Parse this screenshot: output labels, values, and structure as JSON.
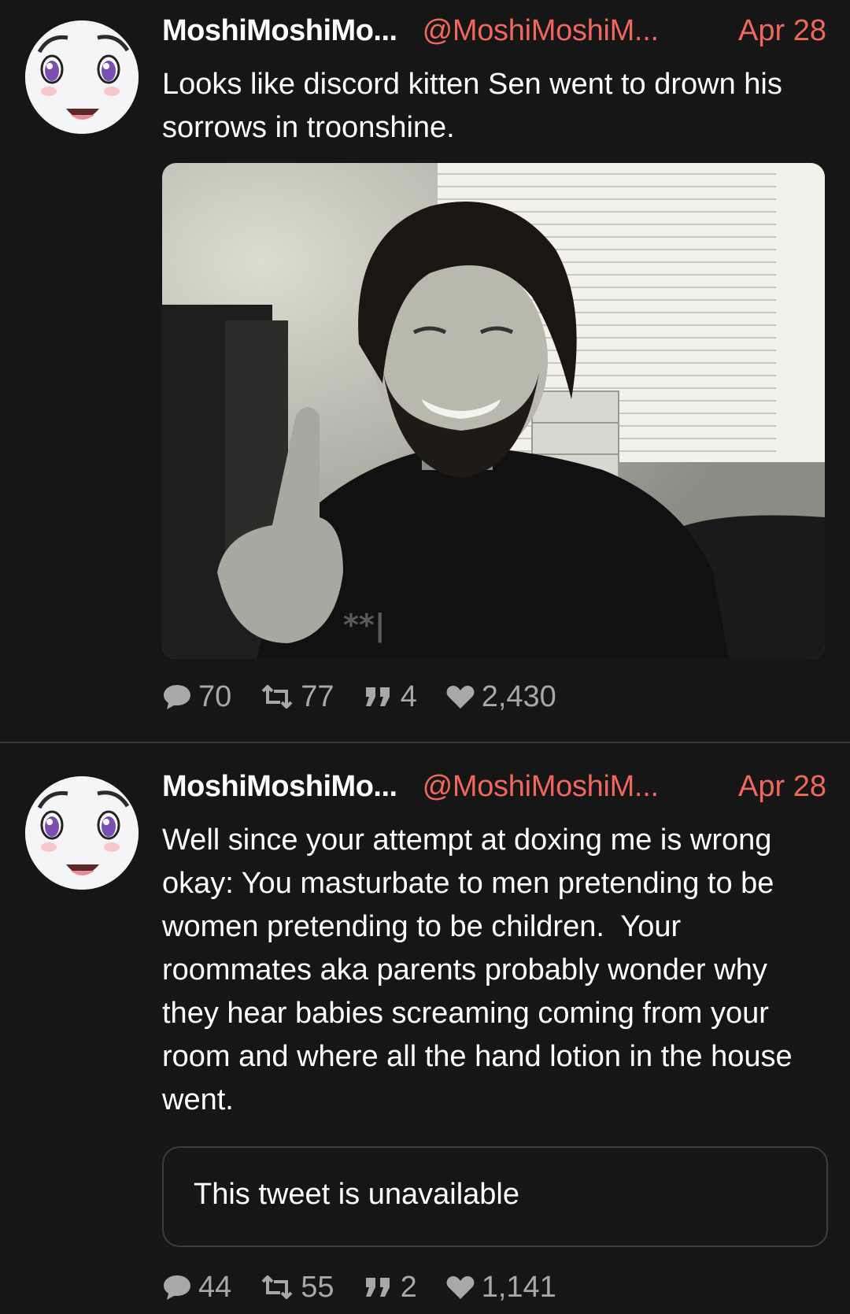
{
  "tweets": [
    {
      "display_name": "MoshiMoshiMo...",
      "handle": "@MoshiMoshiM...",
      "date": "Apr 28",
      "text": "Looks like discord kitten Sen went to drown his sorrows in troonshine.",
      "media_shirt_text": "**|",
      "stats": {
        "replies": "70",
        "retweets": "77",
        "quotes": "4",
        "likes": "2,430"
      }
    },
    {
      "display_name": "MoshiMoshiMo...",
      "handle": "@MoshiMoshiM...",
      "date": "Apr 28",
      "text": "Well since your attempt at doxing me is wrong okay: You masturbate to men pretending to be women pretending to be children.  Your roommates aka parents probably wonder why they hear babies screaming coming from your room and where all the hand lotion in the house went.",
      "quoted_unavailable": "This tweet is unavailable",
      "stats": {
        "replies": "44",
        "retweets": "55",
        "quotes": "2",
        "likes": "1,141"
      }
    }
  ],
  "icons": {
    "reply": "speech-bubble-icon",
    "retweet": "retweet-icon",
    "quote": "quote-icon",
    "like": "heart-icon"
  },
  "colors": {
    "background": "#161616",
    "accent": "#f0675d",
    "muted": "#a8a8a8",
    "divider": "#3a3a3a"
  }
}
